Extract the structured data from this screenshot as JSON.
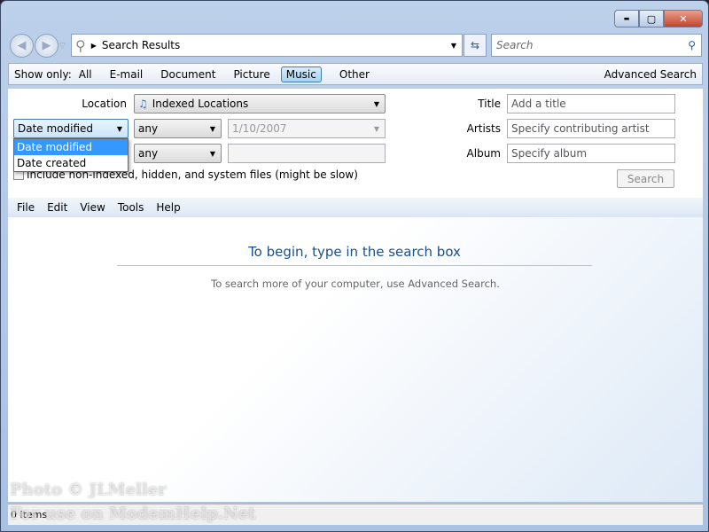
{
  "window": {
    "minimize": "▬",
    "maximize": "▢",
    "close": "✕"
  },
  "address": {
    "path": "Search Results"
  },
  "search": {
    "placeholder": "Search"
  },
  "filter": {
    "label": "Show only:",
    "items": [
      "All",
      "E-mail",
      "Document",
      "Picture",
      "Music",
      "Other"
    ],
    "selected": "Music",
    "advanced": "Advanced Search"
  },
  "form": {
    "location_label": "Location",
    "location_value": "Indexed Locations",
    "date_field": "Date modified",
    "date_options": [
      "Date modified",
      "Date created"
    ],
    "cond1": "any",
    "date1": "1/10/2007",
    "cond2": "any",
    "date2": "",
    "include_label": "Include non-indexed, hidden, and system files (might be slow)",
    "title_label": "Title",
    "title_placeholder": "Add a title",
    "artists_label": "Artists",
    "artists_placeholder": "Specify contributing artist",
    "album_label": "Album",
    "album_placeholder": "Specify album",
    "search_button": "Search"
  },
  "menu": [
    "File",
    "Edit",
    "View",
    "Tools",
    "Help"
  ],
  "main": {
    "heading": "To begin, type in the search box",
    "subtext": "To search more of your computer, use Advanced Search."
  },
  "status": {
    "items": "0 items"
  },
  "watermark": {
    "line1": "Photo © JLMeller",
    "line2": "For use on ModemHelp.Net"
  }
}
